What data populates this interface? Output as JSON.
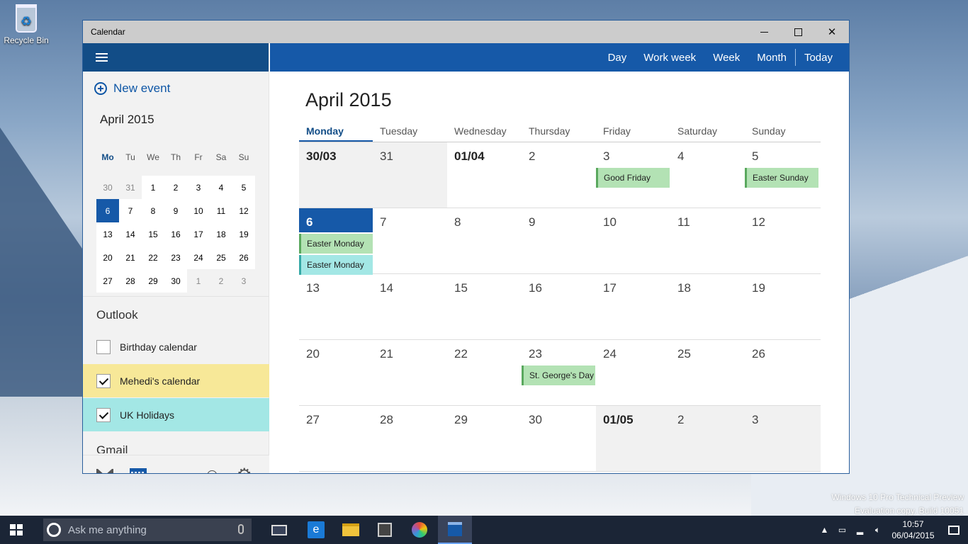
{
  "desktop": {
    "recycle_bin_label": "Recycle Bin",
    "watermark_line1": "Windows 10 Pro Technical Preview",
    "watermark_line2": "Evaluation copy. Build 10051"
  },
  "window": {
    "title": "Calendar",
    "minimize_icon": "minimize-icon",
    "maximize_icon": "maximize-icon",
    "close_glyph": "✕"
  },
  "sidebar": {
    "new_event_label": "New event",
    "mini_calendar": {
      "title": "April 2015",
      "weekdays": [
        "Mo",
        "Tu",
        "We",
        "Th",
        "Fr",
        "Sa",
        "Su"
      ],
      "weeks": [
        [
          "30",
          "31",
          "1",
          "2",
          "3",
          "4",
          "5"
        ],
        [
          "6",
          "7",
          "8",
          "9",
          "10",
          "11",
          "12"
        ],
        [
          "13",
          "14",
          "15",
          "16",
          "17",
          "18",
          "19"
        ],
        [
          "20",
          "21",
          "22",
          "23",
          "24",
          "25",
          "26"
        ],
        [
          "27",
          "28",
          "29",
          "30",
          "1",
          "2",
          "3"
        ]
      ],
      "selected": "6"
    },
    "section_outlook": "Outlook",
    "calendars": [
      {
        "label": "Birthday calendar",
        "checked": false,
        "color": "#f2f2f2"
      },
      {
        "label": "Mehedi's calendar",
        "checked": true,
        "color": "#f7e898"
      },
      {
        "label": "UK Holidays",
        "checked": true,
        "color": "#a3e7e5"
      }
    ],
    "section_gmail": "Gmail",
    "bottom_icons": [
      "mail-icon",
      "calendar-icon",
      "feedback-icon",
      "gear-icon"
    ]
  },
  "topbar": {
    "views": [
      "Day",
      "Work week",
      "Week",
      "Month"
    ],
    "today_label": "Today"
  },
  "month_view": {
    "title": "April 2015",
    "weekdays": [
      "Monday",
      "Tuesday",
      "Wednesday",
      "Thursday",
      "Friday",
      "Saturday",
      "Sunday"
    ],
    "active_weekday": "Monday",
    "weeks": [
      [
        "30/03",
        "31",
        "01/04",
        "2",
        "3",
        "4",
        "5"
      ],
      [
        "6",
        "7",
        "8",
        "9",
        "10",
        "11",
        "12"
      ],
      [
        "13",
        "14",
        "15",
        "16",
        "17",
        "18",
        "19"
      ],
      [
        "20",
        "21",
        "22",
        "23",
        "24",
        "25",
        "26"
      ],
      [
        "27",
        "28",
        "29",
        "30",
        "01/05",
        "2",
        "3"
      ]
    ],
    "events": [
      {
        "label": "Good Friday",
        "week": 0,
        "day": 4,
        "slot": 0,
        "color": "#b3e2b4"
      },
      {
        "label": "Easter Sunday",
        "week": 0,
        "day": 6,
        "slot": 0,
        "color": "#b3e2b4"
      },
      {
        "label": "Easter Monday",
        "week": 1,
        "day": 0,
        "slot": 0,
        "color": "#b3e2b4"
      },
      {
        "label": "Easter Monday",
        "week": 1,
        "day": 0,
        "slot": 1,
        "color": "#a3e7e5"
      },
      {
        "label": "St. George's Day",
        "week": 3,
        "day": 3,
        "slot": 0,
        "color": "#b3e2b4"
      }
    ]
  },
  "taskbar": {
    "search_placeholder": "Ask me anything",
    "time": "10:57",
    "date": "06/04/2015",
    "apps": [
      "task-view-icon",
      "internet-explorer-icon",
      "file-explorer-icon",
      "store-icon",
      "paint-icon",
      "calendar-app-icon"
    ]
  }
}
